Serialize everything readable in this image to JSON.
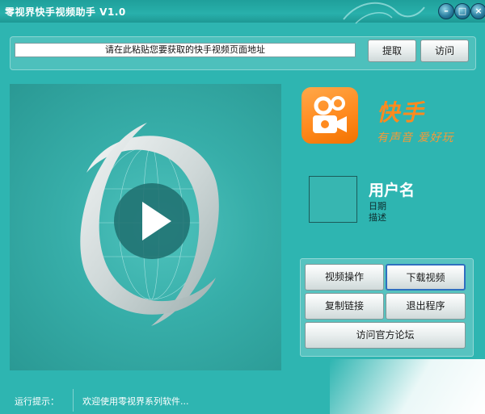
{
  "window": {
    "title": "零视界快手视频助手 V1.0"
  },
  "url": {
    "placeholder": "请在此粘贴您要获取的快手视频页面地址"
  },
  "buttons": {
    "extract": "提取",
    "visit": "访问",
    "video_ops": "视频操作",
    "download": "下载视频",
    "copy_link": "复制链接",
    "exit": "退出程序",
    "forum": "访问官方论坛"
  },
  "brand": {
    "name": "快手",
    "slogan": "有声音 爱好玩"
  },
  "user": {
    "name": "用户名",
    "date": "日期",
    "desc": "描述"
  },
  "status": {
    "label": "运行提示：",
    "message": "欢迎使用零视界系列软件..."
  },
  "colors": {
    "bg": "#2eb5b1",
    "accent": "#ff8a1e"
  },
  "icons": [
    "minimize-icon",
    "maximize-icon",
    "close-icon",
    "play-icon",
    "kuaishou-logo"
  ]
}
